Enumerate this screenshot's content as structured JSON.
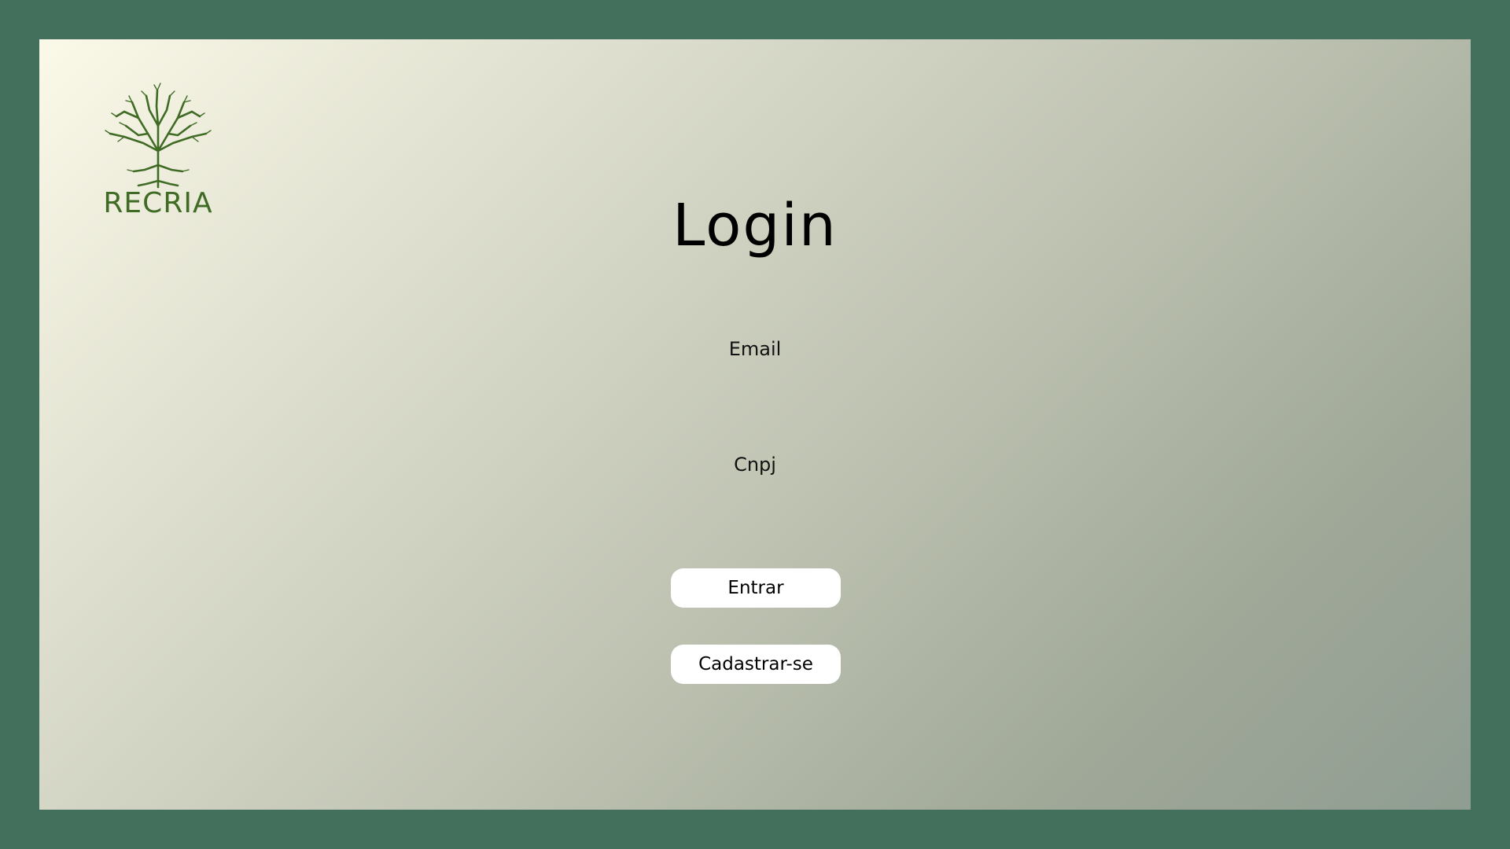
{
  "brand": {
    "name": "RECRIA",
    "logo_icon": "tree-icon",
    "logo_color": "#3f6b25"
  },
  "page": {
    "title": "Login"
  },
  "form": {
    "email_label": "Email",
    "email_value": "",
    "cnpj_label": "Cnpj",
    "cnpj_value": "",
    "submit_label": "Entrar",
    "register_label": "Cadastrar-se"
  },
  "colors": {
    "outer_background": "#436f5d",
    "gradient_start": "#fbf9e8",
    "gradient_end": "#8f9d92",
    "button_background": "#ffffff"
  }
}
